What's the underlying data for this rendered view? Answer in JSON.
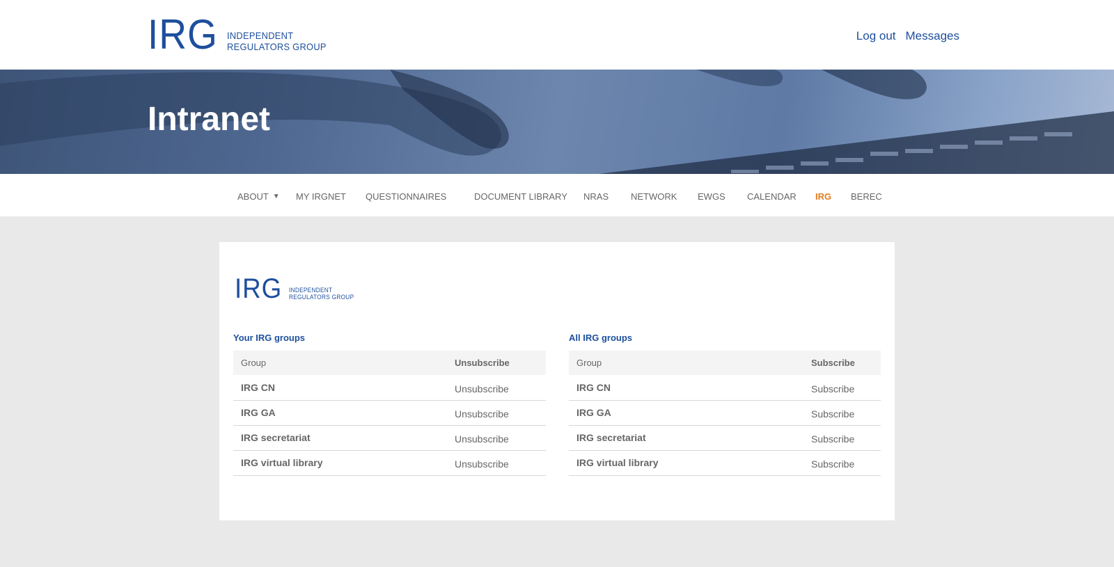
{
  "header": {
    "logo": {
      "mark": "IRG",
      "line1": "INDEPENDENT",
      "line2": "REGULATORS GROUP"
    },
    "links": [
      "Log out",
      "Messages"
    ]
  },
  "hero": {
    "title": "Intranet"
  },
  "nav": {
    "items": [
      {
        "label": "ABOUT",
        "has_dropdown": true
      },
      {
        "label": "MY IRGNET"
      },
      {
        "label": "QUESTIONNAIRES"
      },
      {
        "label": "DOCUMENT LIBRARY"
      },
      {
        "label": "NRAS"
      },
      {
        "label": "NETWORK"
      },
      {
        "label": "EWGS"
      },
      {
        "label": "CALENDAR"
      },
      {
        "label": "IRG",
        "active": true
      },
      {
        "label": "BEREC"
      }
    ],
    "caret": "▼",
    "active_color": "#e07c1f"
  },
  "card": {
    "logo": {
      "mark": "IRG",
      "line1": "INDEPENDENT",
      "line2": "REGULATORS GROUP"
    },
    "your_groups": {
      "title": "Your IRG groups",
      "columns": [
        "Group",
        "Unsubscribe"
      ],
      "rows": [
        {
          "group": "IRG CN",
          "action": "Unsubscribe"
        },
        {
          "group": "IRG GA",
          "action": "Unsubscribe"
        },
        {
          "group": "IRG secretariat",
          "action": "Unsubscribe"
        },
        {
          "group": "IRG virtual library",
          "action": "Unsubscribe"
        }
      ]
    },
    "all_groups": {
      "title": "All IRG groups",
      "columns": [
        "Group",
        "Subscribe"
      ],
      "rows": [
        {
          "group": "IRG CN",
          "action": "Subscribe"
        },
        {
          "group": "IRG GA",
          "action": "Subscribe"
        },
        {
          "group": "IRG secretariat",
          "action": "Subscribe"
        },
        {
          "group": "IRG virtual library",
          "action": "Subscribe"
        }
      ]
    }
  },
  "colors": {
    "brand": "#1d4f9c",
    "page_bg": "#e9e9e9",
    "accent": "#e07c1f"
  }
}
